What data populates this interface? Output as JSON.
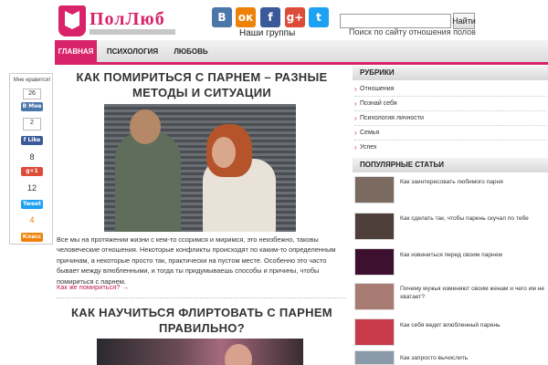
{
  "header": {
    "logo_text": "ПолЛюб",
    "social": {
      "caption": "Наши группы",
      "buttons": [
        {
          "name": "vkontakte",
          "glyph": "В",
          "color": "#4a76a8"
        },
        {
          "name": "odnoklassniki",
          "glyph": "ок",
          "color": "#ee8208"
        },
        {
          "name": "facebook",
          "glyph": "f",
          "color": "#3b5998"
        },
        {
          "name": "google-plus",
          "glyph": "g+",
          "color": "#dd4b39"
        },
        {
          "name": "twitter",
          "glyph": "t",
          "color": "#1da1f2"
        }
      ]
    },
    "search": {
      "placeholder": "",
      "button_label": "Найти",
      "caption": "Поиск по сайту отношения полов"
    }
  },
  "nav": {
    "items": [
      {
        "label": "Главная",
        "active": true
      },
      {
        "label": "Психология",
        "active": false
      },
      {
        "label": "Любовь",
        "active": false
      }
    ],
    "accent_color": "#d8226a"
  },
  "sharebar": {
    "title": "Мне нравится!",
    "like_count": "26",
    "vk_label": "В Мне",
    "vk2_count": "2",
    "fb_label": "f Like",
    "fb_count": "8",
    "gplus_label": "g+1",
    "tw_count": "12",
    "tw_label": "Tweet",
    "ok_count": "4",
    "ok_label": "Класс"
  },
  "posts": [
    {
      "title": "КАК ПОМИРИТЬСЯ С ПАРНЕМ – РАЗНЫЕ МЕТОДЫ И СИТУАЦИИ",
      "excerpt": "Все мы на протяжении жизни с кем-то ссоримся и миримся, это неизбежно, таковы человеческие отношения. Некоторые конфликты происходят по каким-то определенным причинам, а некоторые просто так, практически на пустом месте. Особенно это часто бывает между влюбленными, и тогда ты придумываешь способы и причины, чтобы помириться с парнем.",
      "more_link": "Как же помириться? →"
    },
    {
      "title": "КАК НАУЧИТЬСЯ ФЛИРТОВАТЬ С ПАРНЕМ ПРАВИЛЬНО?"
    }
  ],
  "sidebar": {
    "categories_title": "РУБРИКИ",
    "categories": [
      "Отношения",
      "Познай себя",
      "Психология личности",
      "Семья",
      "Успех"
    ],
    "popular_title": "ПОПУЛЯРНЫЕ СТАТЬИ",
    "popular": [
      {
        "text": "Как заинтересовать любимого парня",
        "thumb_color": "#7a6a60"
      },
      {
        "text": "Как сделать так, чтобы парень скучал по тебе",
        "thumb_color": "#4f3f3a"
      },
      {
        "text": "Как извиниться перед своим парнем",
        "thumb_color": "#3d1030"
      },
      {
        "text": "Почему мужья изменяют своим женам и чего им не хватает?",
        "thumb_color": "#a97c73"
      },
      {
        "text": "Как себя ведет влюбленный парень",
        "thumb_color": "#c83a4a"
      },
      {
        "text": "Как запросто вычислить",
        "thumb_color": "#8b9aa8"
      }
    ]
  }
}
